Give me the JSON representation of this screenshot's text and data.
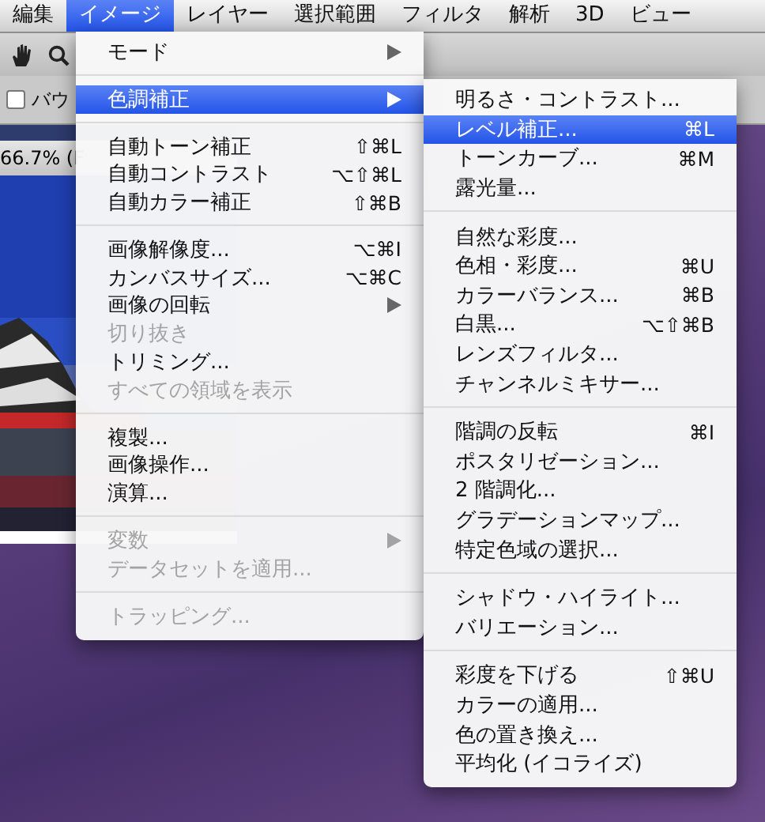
{
  "menu_bar": [
    {
      "label": "編集",
      "selected": false
    },
    {
      "label": "イメージ",
      "selected": true
    },
    {
      "label": "レイヤー",
      "selected": false
    },
    {
      "label": "選択範囲",
      "selected": false
    },
    {
      "label": "フィルタ",
      "selected": false
    },
    {
      "label": "解析",
      "selected": false
    },
    {
      "label": "3D",
      "selected": false
    },
    {
      "label": "ビュー",
      "selected": false
    }
  ],
  "options_bar": {
    "checkbox": {
      "label": "バウ",
      "checked": false
    }
  },
  "document": {
    "title": "66.7% (F"
  },
  "image_menu": [
    {
      "kind": "item",
      "label": "モード",
      "submenu": true,
      "disabled": false,
      "selected": false
    },
    {
      "kind": "separator"
    },
    {
      "kind": "item",
      "label": "色調補正",
      "submenu": true,
      "disabled": false,
      "selected": true
    },
    {
      "kind": "separator"
    },
    {
      "kind": "item",
      "label": "自動トーン補正",
      "shortcut": "⇧⌘L",
      "disabled": false,
      "selected": false
    },
    {
      "kind": "item",
      "label": "自動コントラスト",
      "shortcut": "⌥⇧⌘L",
      "disabled": false,
      "selected": false
    },
    {
      "kind": "item",
      "label": "自動カラー補正",
      "shortcut": "⇧⌘B",
      "disabled": false,
      "selected": false
    },
    {
      "kind": "separator"
    },
    {
      "kind": "item",
      "label": "画像解像度...",
      "shortcut": "⌥⌘I",
      "disabled": false,
      "selected": false
    },
    {
      "kind": "item",
      "label": "カンバスサイズ...",
      "shortcut": "⌥⌘C",
      "disabled": false,
      "selected": false
    },
    {
      "kind": "item",
      "label": "画像の回転",
      "submenu": true,
      "disabled": false,
      "selected": false
    },
    {
      "kind": "item",
      "label": "切り抜き",
      "disabled": true,
      "selected": false
    },
    {
      "kind": "item",
      "label": "トリミング...",
      "disabled": false,
      "selected": false
    },
    {
      "kind": "item",
      "label": "すべての領域を表示",
      "disabled": true,
      "selected": false
    },
    {
      "kind": "separator"
    },
    {
      "kind": "item",
      "label": "複製...",
      "disabled": false,
      "selected": false
    },
    {
      "kind": "item",
      "label": "画像操作...",
      "disabled": false,
      "selected": false
    },
    {
      "kind": "item",
      "label": "演算...",
      "disabled": false,
      "selected": false
    },
    {
      "kind": "separator"
    },
    {
      "kind": "item",
      "label": "変数",
      "submenu": true,
      "disabled": true,
      "selected": false
    },
    {
      "kind": "item",
      "label": "データセットを適用...",
      "disabled": true,
      "selected": false
    },
    {
      "kind": "separator"
    },
    {
      "kind": "item",
      "label": "トラッピング...",
      "disabled": true,
      "selected": false
    }
  ],
  "adjustments_submenu": [
    {
      "kind": "item",
      "label": "明るさ・コントラスト...",
      "selected": false
    },
    {
      "kind": "item",
      "label": "レベル補正...",
      "shortcut": "⌘L",
      "selected": true
    },
    {
      "kind": "item",
      "label": "トーンカーブ...",
      "shortcut": "⌘M",
      "selected": false
    },
    {
      "kind": "item",
      "label": "露光量...",
      "selected": false
    },
    {
      "kind": "separator"
    },
    {
      "kind": "item",
      "label": "自然な彩度...",
      "selected": false
    },
    {
      "kind": "item",
      "label": "色相・彩度...",
      "shortcut": "⌘U",
      "selected": false
    },
    {
      "kind": "item",
      "label": "カラーバランス...",
      "shortcut": "⌘B",
      "selected": false
    },
    {
      "kind": "item",
      "label": "白黒...",
      "shortcut": "⌥⇧⌘B",
      "selected": false
    },
    {
      "kind": "item",
      "label": "レンズフィルタ...",
      "selected": false
    },
    {
      "kind": "item",
      "label": "チャンネルミキサー...",
      "selected": false
    },
    {
      "kind": "separator"
    },
    {
      "kind": "item",
      "label": "階調の反転",
      "shortcut": "⌘I",
      "selected": false
    },
    {
      "kind": "item",
      "label": "ポスタリゼーション...",
      "selected": false
    },
    {
      "kind": "item",
      "label": "2 階調化...",
      "selected": false
    },
    {
      "kind": "item",
      "label": "グラデーションマップ...",
      "selected": false
    },
    {
      "kind": "item",
      "label": "特定色域の選択...",
      "selected": false
    },
    {
      "kind": "separator"
    },
    {
      "kind": "item",
      "label": "シャドウ・ハイライト...",
      "selected": false
    },
    {
      "kind": "item",
      "label": "バリエーション...",
      "selected": false
    },
    {
      "kind": "separator"
    },
    {
      "kind": "item",
      "label": "彩度を下げる",
      "shortcut": "⇧⌘U",
      "selected": false
    },
    {
      "kind": "item",
      "label": "カラーの適用...",
      "selected": false
    },
    {
      "kind": "item",
      "label": "色の置き換え...",
      "selected": false
    },
    {
      "kind": "item",
      "label": "平均化 (イコライズ)",
      "selected": false
    }
  ]
}
